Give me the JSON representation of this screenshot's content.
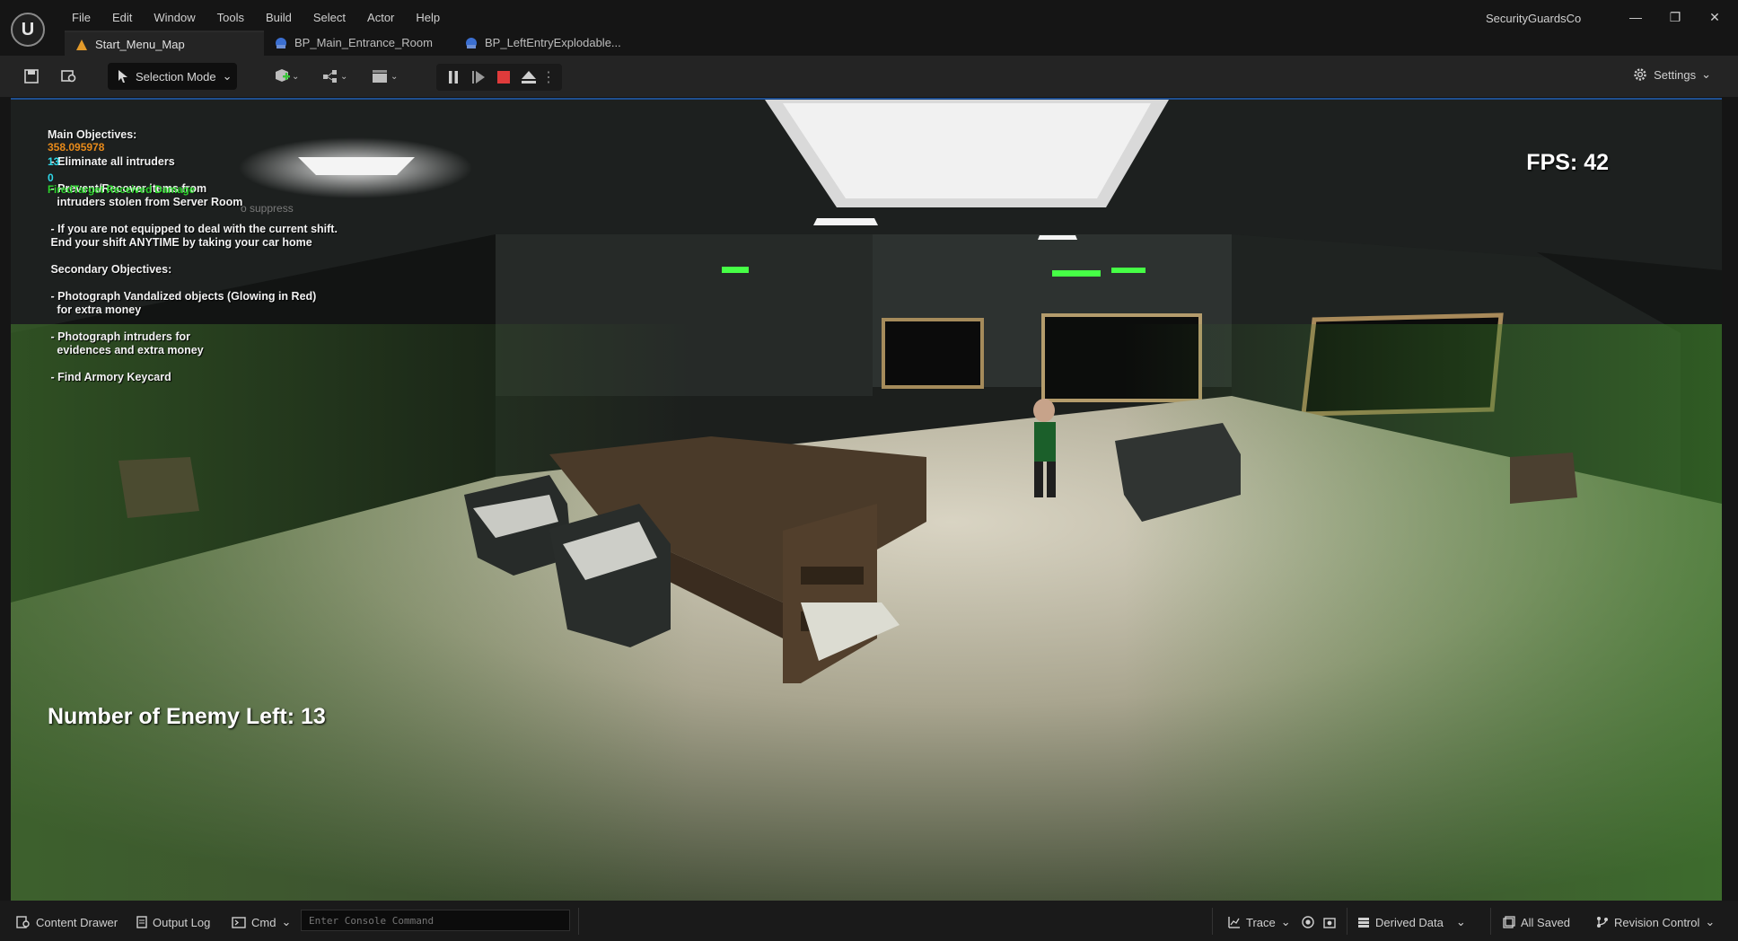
{
  "app": {
    "logo_text": "U",
    "project_name": "SecurityGuardsCo",
    "menu": [
      "File",
      "Edit",
      "Window",
      "Tools",
      "Build",
      "Select",
      "Actor",
      "Help"
    ],
    "window_controls": {
      "minimize": "—",
      "restore": "❐",
      "close": "✕"
    }
  },
  "tabs": [
    {
      "label": "Start_Menu_Map",
      "icon": "map-warning-icon",
      "active": true
    },
    {
      "label": "BP_Main_Entrance_Room",
      "icon": "blueprint-icon",
      "active": false
    },
    {
      "label": "BP_LeftEntryExplodable...",
      "icon": "blueprint-icon",
      "active": false
    }
  ],
  "toolbar": {
    "selection_mode": "Selection Mode",
    "settings": "Settings"
  },
  "hud": {
    "objectives_text": "Main Objectives:\n\n - Eliminate all intruders\n\n - Prevent/Recover items from\n   intruders stolen from Server Room\n\n - If you are not equipped to deal with the current shift.\n End your shift ANYTIME by taking your car home\n\n Secondary Objectives:\n\n - Photograph Vandalized objects (Glowing in Red)\n   for extra money\n\n - Photograph intruders for\n   evidences and extra money\n\n - Find Armory Keycard",
    "debug_orange": "358.095978",
    "debug_cyan_1": "13",
    "debug_cyan_2": "0",
    "debug_green": "FiredTarget Received Damage",
    "debug_grey": "o suppress",
    "fps": "FPS: 42",
    "enemy_left": "Number of Enemy Left: 13"
  },
  "statusbar": {
    "content_drawer": "Content Drawer",
    "output_log": "Output Log",
    "cmd": "Cmd",
    "console_placeholder": "Enter Console Command",
    "trace": "Trace",
    "derived_data": "Derived Data",
    "all_saved": "All Saved",
    "revision_control": "Revision Control"
  },
  "colors": {
    "accent_blue": "#1f4e8f",
    "stop_red": "#e03b3b",
    "hud_green": "#2cd42c",
    "hud_orange": "#e88a1a"
  }
}
